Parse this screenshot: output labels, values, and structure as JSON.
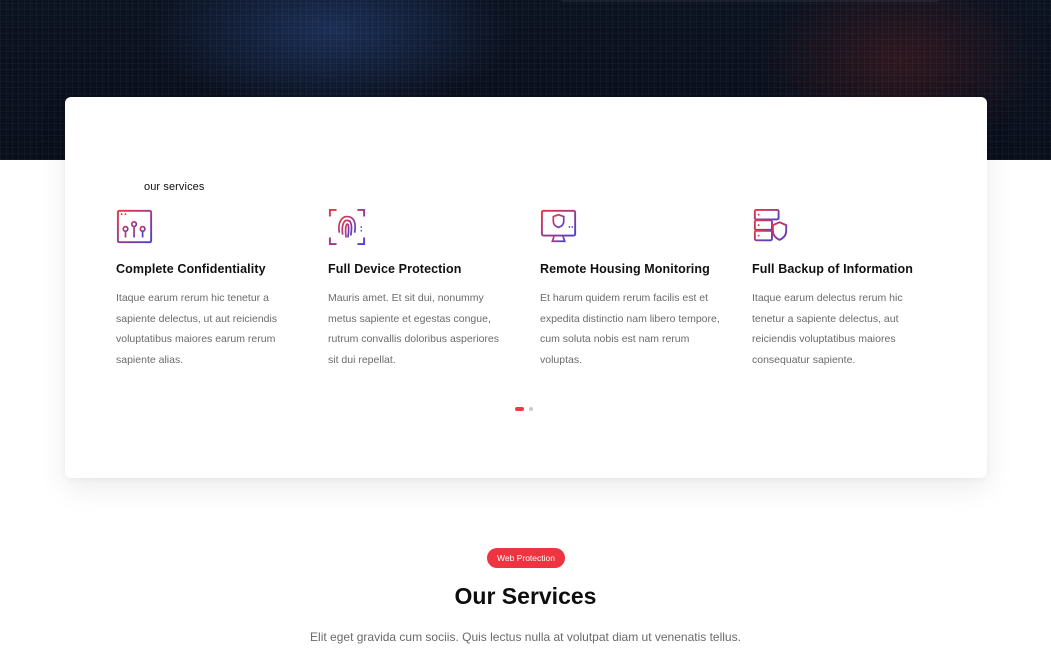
{
  "hero": {
    "background": "dark-cyber-image"
  },
  "services_card": {
    "label": "our services",
    "items": [
      {
        "icon": "browser-circuit-icon",
        "title": "Complete Confidentiality",
        "text": "Itaque earum rerum hic tenetur a sapiente delectus, ut aut reiciendis voluptatibus maiores earum rerum sapiente alias."
      },
      {
        "icon": "fingerprint-icon",
        "title": "Full Device Protection",
        "text": "Mauris amet. Et sit dui, nonummy metus sapiente et egestas congue, rutrum convallis doloribus asperiores sit dui repellat."
      },
      {
        "icon": "monitor-shield-icon",
        "title": "Remote Housing Monitoring",
        "text": "Et harum quidem rerum facilis est et expedita distinctio nam libero tempore, cum soluta nobis est nam rerum voluptas."
      },
      {
        "icon": "server-shield-icon",
        "title": "Full Backup of Information",
        "text": "Itaque earum delectus rerum hic tenetur a sapiente delectus, aut reiciendis voluptatibus maiores consequatur sapiente."
      }
    ],
    "pagination": {
      "pages": 2,
      "active": 1
    }
  },
  "section": {
    "badge": "Web Protection",
    "title": "Our Services",
    "subtitle": "Elit eget gravida cum sociis. Quis lectus nulla at volutpat diam ut venenatis tellus."
  },
  "colors": {
    "accent": "#ef3340",
    "icon_gradient_start": "#ef3340",
    "icon_gradient_end": "#4b3fd6",
    "text_muted": "#6b6b6b"
  }
}
